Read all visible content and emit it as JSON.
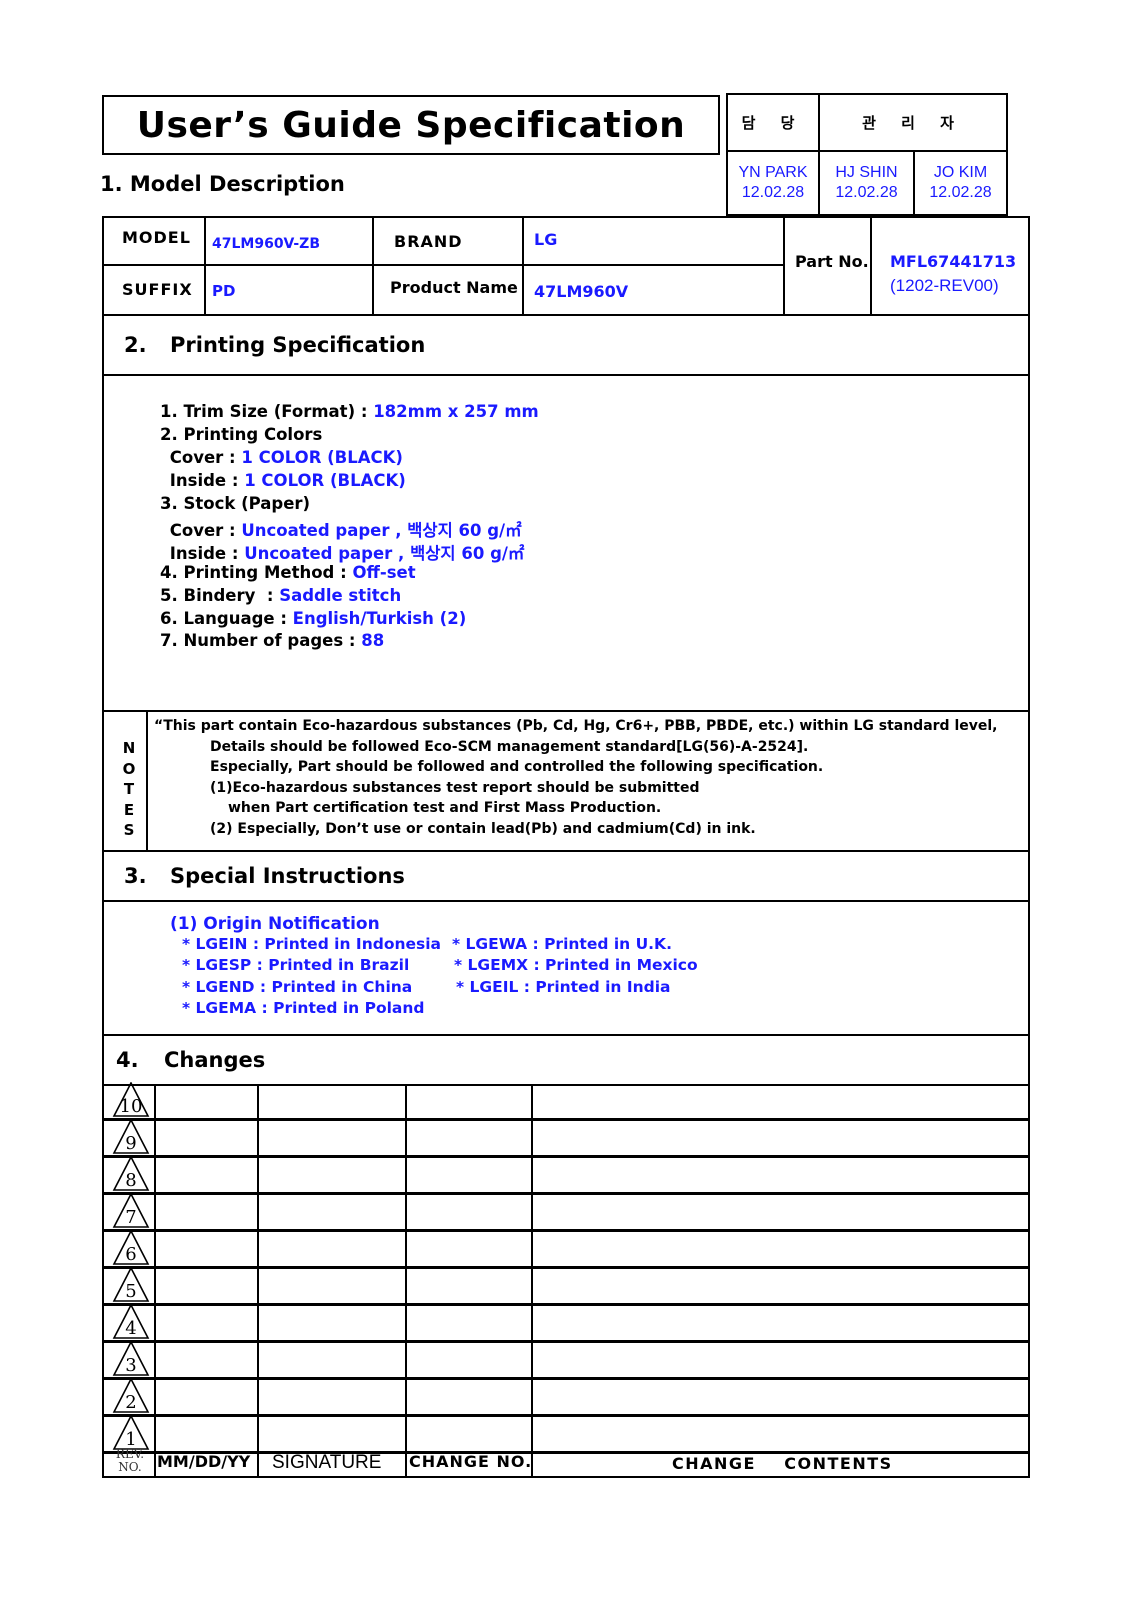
{
  "document": {
    "title": "User’s Guide Specification"
  },
  "approval": {
    "headers": {
      "author": "담  당",
      "manager": "관 리 자"
    },
    "signers": [
      {
        "name": "YN PARK",
        "date": "12.02.28"
      },
      {
        "name": "HJ SHIN",
        "date": "12.02.28"
      },
      {
        "name": "JO KIM",
        "date": "12.02.28"
      }
    ]
  },
  "model_description": {
    "heading": "1. Model Description",
    "model_label": "MODEL",
    "model_value": "47LM960V-ZB",
    "brand_label": "BRAND",
    "brand_value": "LG",
    "suffix_label": "SUFFIX",
    "suffix_value": "PD",
    "product_name_label": "Product Name",
    "product_name_value": "47LM960V",
    "part_no_label": "Part No.",
    "part_no_value": "MFL67441713",
    "part_no_rev": "(1202-REV00)"
  },
  "printing_spec": {
    "number": "2.",
    "heading": "Printing Specification",
    "items": [
      {
        "label": "1. Trim Size (Format) : ",
        "value": "182mm x 257 mm"
      },
      {
        "label": "2. Printing Colors",
        "value": ""
      },
      {
        "label": " Cover : ",
        "value": "1 COLOR (BLACK)"
      },
      {
        "label": " Inside : ",
        "value": "1 COLOR (BLACK)"
      },
      {
        "label": "3. Stock (Paper)",
        "value": ""
      },
      {
        "label": " Cover : ",
        "value": "Uncoated paper , 백상지 60 g/㎡"
      },
      {
        "label": " Inside : ",
        "value": "Uncoated paper , 백상지 60 g/㎡"
      },
      {
        "label": "4. Printing Method : ",
        "value": "Off-set"
      },
      {
        "label": "5. Bindery  : ",
        "value": "Saddle stitch"
      },
      {
        "label": "6. Language : ",
        "value": "English/Turkish (2)"
      },
      {
        "label": "7. Number of pages : ",
        "value": "88"
      }
    ]
  },
  "notes": {
    "side_label": [
      "N",
      "O",
      "T",
      "E",
      "S"
    ],
    "lines": [
      "“This part contain Eco-hazardous substances (Pb, Cd, Hg, Cr6+, PBB, PBDE, etc.) within LG standard level,",
      "Details should be followed Eco-SCM management standard[LG(56)-A-2524].",
      "Especially, Part should be followed and controlled the following specification.",
      "(1)Eco-hazardous substances test report should be submitted",
      "when  Part certification test and First Mass Production.",
      "(2) Especially, Don’t use or contain lead(Pb) and cadmium(Cd) in ink."
    ]
  },
  "special_instructions": {
    "number": "3.",
    "heading": "Special Instructions",
    "origin_title": "(1) Origin Notification",
    "origins_left": [
      "* LGEIN : Printed in Indonesia",
      "* LGESP : Printed in Brazil",
      "* LGEND : Printed in China",
      "* LGEMA : Printed in Poland"
    ],
    "origins_right": [
      "* LGEWA : Printed in U.K.",
      "* LGEMX : Printed in Mexico",
      "* LGEIL : Printed in India"
    ]
  },
  "changes": {
    "number": "4.",
    "heading": "Changes",
    "rev_numbers": [
      "10",
      "9",
      "8",
      "7",
      "6",
      "5",
      "4",
      "3",
      "2",
      "1"
    ],
    "columns": {
      "rev_no_line1": "REV.",
      "rev_no_line2": "NO.",
      "date": "MM/DD/YY",
      "signature": "SIGNATURE",
      "change_no": "CHANGE NO.",
      "contents": "CHANGE    CONTENTS"
    }
  }
}
